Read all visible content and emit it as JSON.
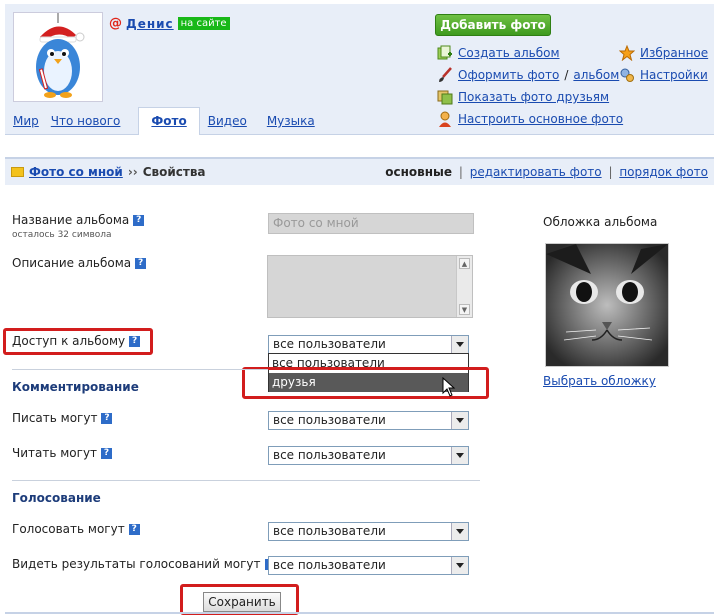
{
  "profile": {
    "at_sign": "@",
    "username": "Денис",
    "online_badge": "на сайте"
  },
  "tabs": [
    {
      "label": "Мир"
    },
    {
      "label": "Что нового"
    },
    {
      "label": "Фото",
      "active": true
    },
    {
      "label": "Видео"
    },
    {
      "label": "Музыка"
    }
  ],
  "actions": {
    "add_photo": "Добавить фото",
    "create_album": "Создать альбом",
    "design_photo": "Оформить фото",
    "slash": "/",
    "album": "альбом",
    "show_friends_photos": "Показать фото друзьям",
    "set_main_photo": "Настроить основное фото",
    "favorites": "Избранное",
    "settings": "Настройки"
  },
  "breadcrumb": {
    "album": "Фото со мной",
    "separator": "››",
    "current": "Свойства",
    "right": {
      "basic": "основные",
      "edit_photo": "редактировать фото",
      "photo_order": "порядок фото",
      "pipe": "|"
    }
  },
  "form": {
    "album_name_label": "Название альбома",
    "album_name_hint": "осталось 32 символа",
    "album_name_value": "Фото со мной",
    "description_label": "Описание альбома",
    "access_label": "Доступ к альбому",
    "access_value": "все пользователи",
    "access_options": [
      "все пользователи",
      "друзья"
    ],
    "commenting_title": "Комментирование",
    "write_label": "Писать могут",
    "write_value": "все пользователи",
    "read_label": "Читать могут",
    "read_value": "все пользователи",
    "voting_title": "Голосование",
    "vote_label": "Голосовать могут",
    "vote_value": "все пользователи",
    "results_label": "Видеть результаты голосований могут",
    "results_value": "все пользователи",
    "help_mark": "?",
    "save_button": "Сохранить"
  },
  "cover": {
    "title": "Обложка альбома",
    "choose_link": "Выбрать обложку"
  },
  "colors": {
    "link": "#1a4bb0",
    "highlight_box": "#d21d1d",
    "add_button": "#4aa82a",
    "header_bg": "#e8eef8"
  }
}
